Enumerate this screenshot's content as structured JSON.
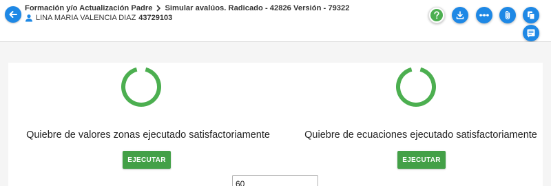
{
  "header": {
    "breadcrumb": {
      "parent": "Formación y/o Actualización Padre",
      "current": "Simular avalúos. Radicado - 42826 Versión - 79322"
    },
    "user": {
      "name": "LINA MARIA VALENCIA DIAZ",
      "id": "43729103"
    },
    "icons": {
      "back": "arrow-left-icon",
      "help": "help-icon",
      "download": "download-icon",
      "more": "more-horizontal-icon",
      "attach": "paperclip-icon",
      "copy": "copy-icon",
      "notes": "notes-icon",
      "user": "user-icon"
    }
  },
  "process": {
    "zones": {
      "status": "Quiebre de valores zonas ejecutado satisfactoriamente",
      "button": "EJECUTAR"
    },
    "equations": {
      "status": "Quiebre de ecuaciones ejecutado satisfactoriamente",
      "button": "EJECUTAR"
    },
    "input_value": "60"
  },
  "colors": {
    "primary": "#1e88e5",
    "success": "#43a047",
    "spinner": "#4caf50"
  }
}
